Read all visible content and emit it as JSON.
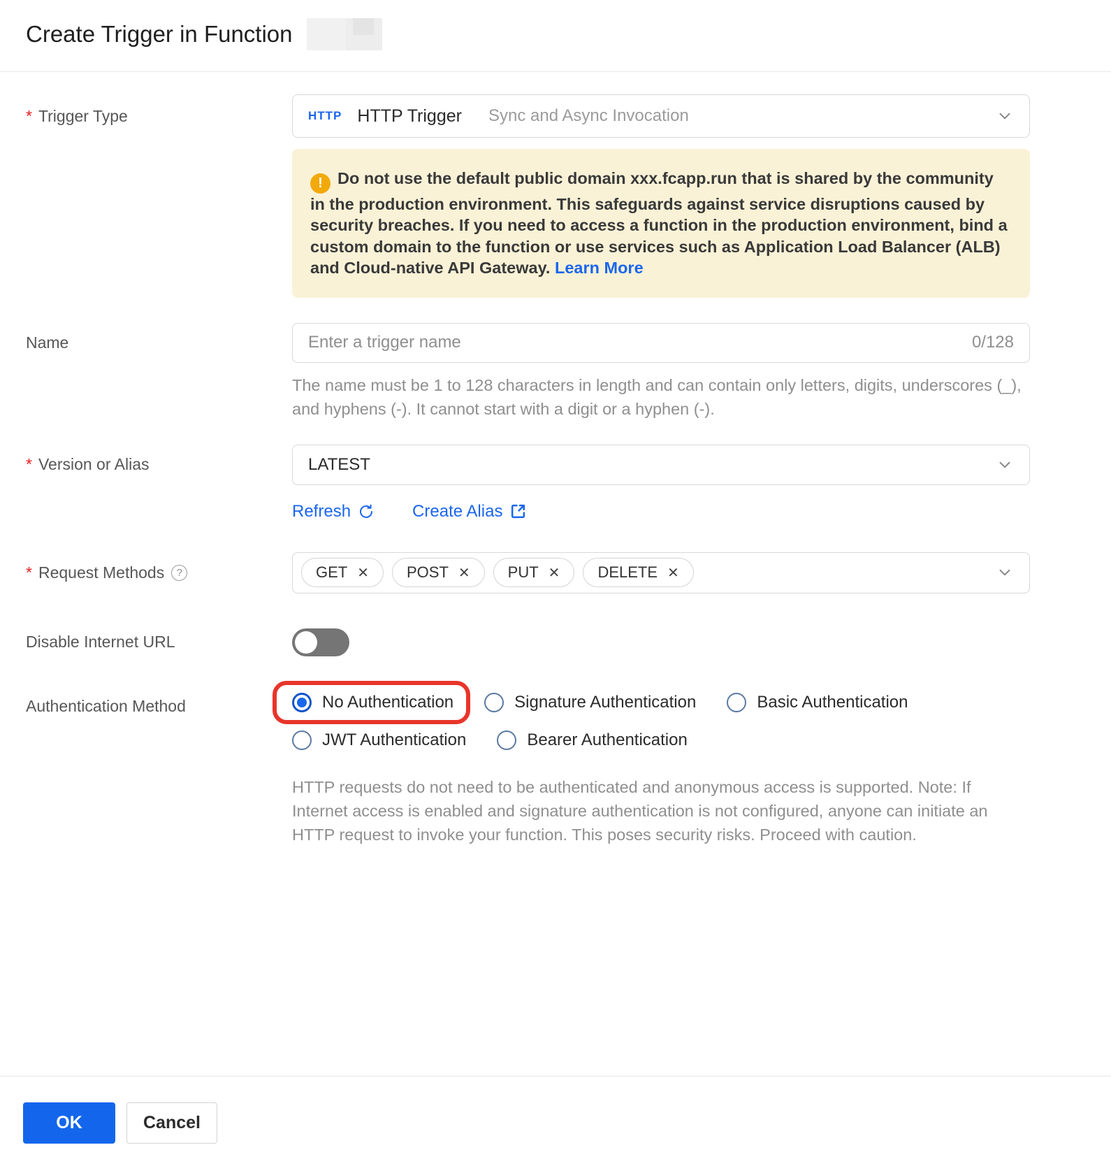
{
  "header": {
    "title": "Create Trigger in Function"
  },
  "ui": {
    "required_marker": "*",
    "question_glyph": "?",
    "warning_glyph": "!",
    "remove_glyph": "✕"
  },
  "colors": {
    "accent_blue": "#1a66ec",
    "ok_button_blue": "#1366ec",
    "warning_bg": "#faf2d7",
    "warning_icon": "#f2a90a",
    "annotation_red": "#e8352a",
    "asterisk_red": "#e02020"
  },
  "form": {
    "trigger_type": {
      "label": "Trigger Type",
      "badge": "HTTP",
      "value": "HTTP Trigger",
      "description": "Sync and Async Invocation"
    },
    "warning": {
      "text": "Do not use the default public domain xxx.fcapp.run that is shared by the community in the production environment. This safeguards against service disruptions caused by security breaches. If you need to access a function in the production environment, bind a custom domain to the function or use services such as Application Load Balancer (ALB) and Cloud-native API Gateway.",
      "link": "Learn More"
    },
    "name": {
      "label": "Name",
      "placeholder": "Enter a trigger name",
      "counter": "0/128",
      "help": "The name must be 1 to 128 characters in length and can contain only letters, digits, underscores (_), and hyphens (-). It cannot start with a digit or a hyphen (-)."
    },
    "version_or_alias": {
      "label": "Version or Alias",
      "value": "LATEST",
      "refresh_link": "Refresh",
      "create_alias_link": "Create Alias"
    },
    "request_methods": {
      "label": "Request Methods",
      "tags": [
        "GET",
        "POST",
        "PUT",
        "DELETE"
      ]
    },
    "disable_internet_url": {
      "label": "Disable Internet URL",
      "enabled": false
    },
    "authentication_method": {
      "label": "Authentication Method",
      "selected": "No Authentication",
      "options": [
        {
          "label": "No Authentication"
        },
        {
          "label": "Signature Authentication"
        },
        {
          "label": "Basic Authentication"
        },
        {
          "label": "JWT Authentication"
        },
        {
          "label": "Bearer Authentication"
        }
      ],
      "help": "HTTP requests do not need to be authenticated and anonymous access is supported. Note: If Internet access is enabled and signature authentication is not configured, anyone can initiate an HTTP request to invoke your function. This poses security risks. Proceed with caution."
    }
  },
  "footer": {
    "ok_label": "OK",
    "cancel_label": "Cancel"
  }
}
